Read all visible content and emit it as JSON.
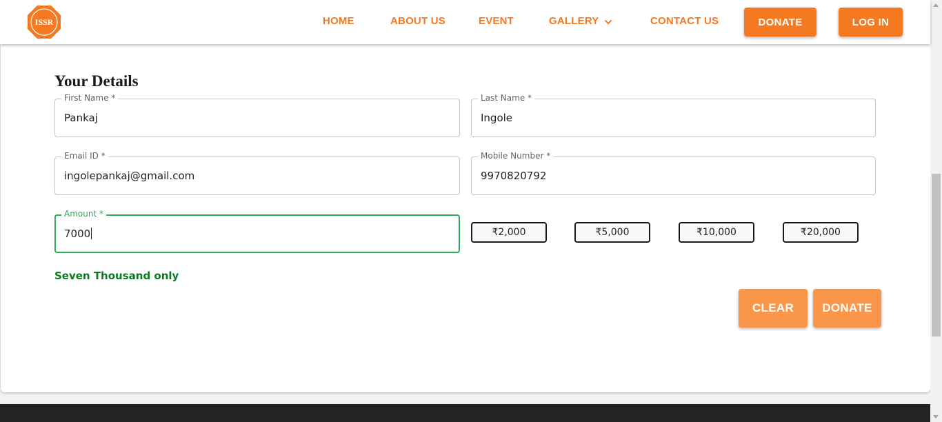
{
  "header": {
    "logo_text": "ISSR",
    "nav": {
      "home": "HOME",
      "about": "ABOUT US",
      "event": "EVENT",
      "gallery": "GALLERY",
      "contact": "CONTACT US"
    },
    "donate_label": "DONATE",
    "login_label": "LOG IN"
  },
  "form": {
    "title": "Your Details",
    "first_name": {
      "label": "First Name *",
      "value": "Pankaj"
    },
    "last_name": {
      "label": "Last Name *",
      "value": "Ingole"
    },
    "email": {
      "label": "Email ID *",
      "value": "ingolepankaj@gmail.com"
    },
    "mobile": {
      "label": "Mobile Number *",
      "value": "9970820792"
    },
    "amount": {
      "label": "Amount *",
      "value": "7000"
    },
    "presets": [
      "₹2,000",
      "₹5,000",
      "₹10,000",
      "₹20,000"
    ],
    "amount_words": "Seven Thousand only",
    "clear_label": "CLEAR",
    "donate_label": "DONATE"
  },
  "icons": {
    "gallery_dropdown": "chevron-down-icon",
    "logo": "issr-logo-icon"
  },
  "colors": {
    "brand_orange": "#f47920",
    "action_orange": "#f9964a",
    "focus_green": "#2eaa5c",
    "words_green": "#0a7a1f",
    "footer": "#232323"
  }
}
